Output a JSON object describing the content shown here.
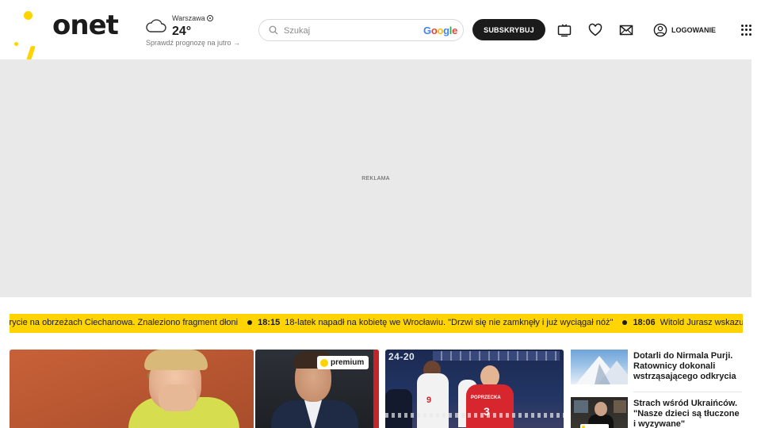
{
  "header": {
    "logo_text": "onet",
    "weather": {
      "city": "Warszawa",
      "temperature": "24°",
      "forecast_link": "Sprawdź prognozę na jutro →"
    },
    "search": {
      "placeholder": "Szukaj",
      "provider": {
        "g": "G",
        "o1": "o",
        "o2": "o",
        "g2": "g",
        "l": "l",
        "e": "e"
      }
    },
    "subscribe_label": "SUBSKRYBUJ",
    "login_label": "LOGOWANIE"
  },
  "ad": {
    "label": "REKLAMA"
  },
  "ticker": {
    "lead_text": "krycie na obrzeżach Ciechanowa. Znaleziono fragment dłoni",
    "items": [
      {
        "time": "18:15",
        "text": "18-latek napadł na kobietę we Wrocławiu. \"Drzwi się nie zamknęły i już wyciągał nóż\""
      },
      {
        "time": "18:06",
        "text": "Witold Jurasz wskazuje na r"
      }
    ]
  },
  "cards": {
    "premium_badge": "premium",
    "volley_score": "24-20",
    "volley_jersey_1": "9",
    "volley_jersey_2_name": "POPRZECKA",
    "volley_jersey_2": "3"
  },
  "side_news": [
    {
      "title": "Dotarli do Nirmala Purji. Ratownicy dokonali wstrząsającego odkrycia"
    },
    {
      "title": "Strach wśród Ukraińców. \"Nasze dzieci są tłuczone i wyzywane\""
    }
  ],
  "colors": {
    "brand_yellow": "#ffd400",
    "dark": "#1b1b1b",
    "ad_bg": "#e9e9e9"
  }
}
